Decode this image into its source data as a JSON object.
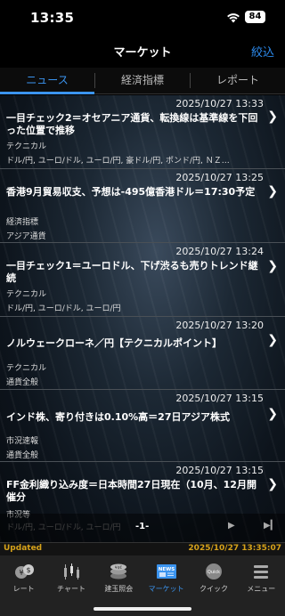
{
  "status_bar": {
    "time": "13:35",
    "battery": "84"
  },
  "nav": {
    "title": "マーケット",
    "filter_label": "絞込"
  },
  "tabs": [
    {
      "label": "ニュース",
      "active": true
    },
    {
      "label": "経済指標",
      "active": false
    },
    {
      "label": "レポート",
      "active": false
    }
  ],
  "news": [
    {
      "time": "2025/10/27 13:33",
      "headline": "一目チェック2＝オセアニア通貨、転換線は基準線を下回った位置で推移",
      "categories": [
        "テクニカル",
        "ドル/円, ユーロ/ドル, ユーロ/円, 豪ドル/円, ポンド/円, ＮＺ…"
      ]
    },
    {
      "time": "2025/10/27 13:25",
      "headline": "香港9月貿易収支、予想は-495億香港ドル＝17:30予定",
      "categories": [
        "経済指標",
        "アジア通貨"
      ]
    },
    {
      "time": "2025/10/27 13:24",
      "headline": "一目チェック1＝ユーロドル、下げ渋るも売りトレンド継続",
      "categories": [
        "テクニカル",
        "ドル/円, ユーロ/ドル, ユーロ/円"
      ]
    },
    {
      "time": "2025/10/27 13:20",
      "headline": "ノルウェークローネ／円【テクニカルポイント】",
      "categories": [
        "テクニカル",
        "通貨全般"
      ]
    },
    {
      "time": "2025/10/27 13:15",
      "headline": "インド株、寄り付きは0.10%高＝27日アジア株式",
      "categories": [
        "市況速報",
        "通貨全般"
      ]
    },
    {
      "time": "2025/10/27 13:15",
      "headline": "FF金利織り込み度＝日本時間27日現在（10月、12月開催分",
      "categories": [
        "市況等",
        "ドル/円, ユーロ/ドル, ユーロ/円"
      ]
    }
  ],
  "pager": {
    "label": "-1-"
  },
  "updated": {
    "label": "Updated",
    "time": "2025/10/27 13:35:07"
  },
  "tab_bar": [
    {
      "label": "レート",
      "icon": "rate-icon",
      "active": false
    },
    {
      "label": "チャート",
      "icon": "chart-icon",
      "active": false
    },
    {
      "label": "建玉照会",
      "icon": "position-icon",
      "active": false
    },
    {
      "label": "マーケット",
      "icon": "news-icon",
      "active": true
    },
    {
      "label": "クイック",
      "icon": "quick-icon",
      "active": false
    },
    {
      "label": "メニュー",
      "icon": "menu-icon",
      "active": false
    }
  ],
  "colors": {
    "accent": "#3b94ef",
    "updated": "#d6a21a"
  }
}
